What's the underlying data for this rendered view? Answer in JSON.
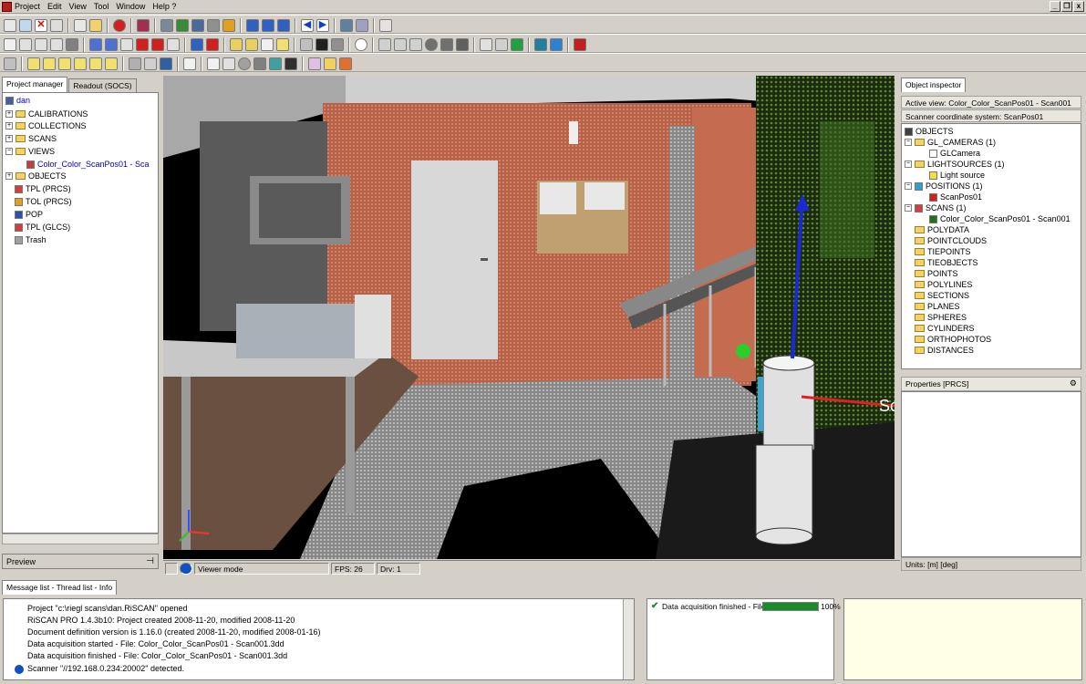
{
  "menubar": {
    "items": [
      "Project",
      "Edit",
      "View",
      "Tool",
      "Window",
      "Help ?"
    ],
    "window_buttons": [
      "_",
      "❐",
      "x"
    ]
  },
  "left_panel": {
    "tabs": [
      "Project manager",
      "Readout (SOCS)"
    ],
    "root": "dan",
    "tree": [
      {
        "label": "CALIBRATIONS"
      },
      {
        "label": "COLLECTIONS"
      },
      {
        "label": "SCANS"
      },
      {
        "label": "VIEWS"
      },
      {
        "label": "Color_Color_ScanPos01 - Sca"
      },
      {
        "label": "OBJECTS"
      },
      {
        "label": "TPL (PRCS)"
      },
      {
        "label": "TOL (PRCS)"
      },
      {
        "label": "POP"
      },
      {
        "label": "TPL (GLCS)"
      },
      {
        "label": "Trash"
      }
    ],
    "preview_label": "Preview"
  },
  "viewport_status": {
    "mode": "Viewer mode",
    "fps": "FPS: 26",
    "drv": "Drv: 1"
  },
  "viewport_overlay": {
    "label_fragment": "Sc"
  },
  "right_panel": {
    "tab": "Object inspector",
    "active_view": "Active view: Color_Color_ScanPos01 - Scan001",
    "coord_system": "Scanner coordinate system: ScanPos01",
    "tree": [
      {
        "label": "OBJECTS"
      },
      {
        "label": "GL_CAMERAS (1)"
      },
      {
        "label": "GLCamera"
      },
      {
        "label": "LIGHTSOURCES (1)"
      },
      {
        "label": "Light source"
      },
      {
        "label": "POSITIONS (1)"
      },
      {
        "label": "ScanPos01"
      },
      {
        "label": "SCANS (1)"
      },
      {
        "label": "Color_Color_ScanPos01 - Scan001"
      },
      {
        "label": "POLYDATA"
      },
      {
        "label": "POINTCLOUDS"
      },
      {
        "label": "TIEPOINTS"
      },
      {
        "label": "TIEOBJECTS"
      },
      {
        "label": "POINTS"
      },
      {
        "label": "POLYLINES"
      },
      {
        "label": "SECTIONS"
      },
      {
        "label": "PLANES"
      },
      {
        "label": "SPHERES"
      },
      {
        "label": "CYLINDERS"
      },
      {
        "label": "ORTHOPHOTOS"
      },
      {
        "label": "DISTANCES"
      }
    ],
    "properties_label": "Properties [PRCS]",
    "units": "Units: [m] [deg]"
  },
  "bottom": {
    "tab": "Message list - Thread list - Info",
    "messages": [
      "Project \"c:\\riegl scans\\dan.RiSCAN\" opened",
      "RiSCAN PRO 1.4.3b10: Project created 2008-11-20, modified 2008-11-20",
      "Document definition version is 1.16.0 (created 2008-11-20, modified 2008-01-16)",
      "Data acquisition started - File: Color_Color_ScanPos01 - Scan001.3dd",
      "Data acquisition finished - File: Color_Color_ScanPos01 - Scan001.3dd",
      "Scanner \"//192.168.0.234:20002\" detected."
    ],
    "progress_label": "Data acquisition finished - File:...",
    "progress_value": "100%",
    "progress_fraction": 1.0
  }
}
